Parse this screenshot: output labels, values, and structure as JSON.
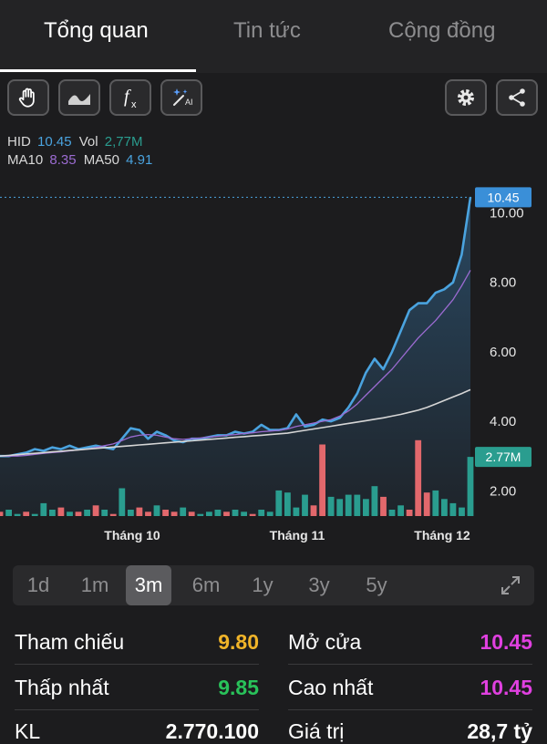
{
  "tabs": [
    {
      "label": "Tổng quan",
      "active": true
    },
    {
      "label": "Tin tức",
      "active": false
    },
    {
      "label": "Cộng đồng",
      "active": false
    }
  ],
  "toolbar": {
    "icons": [
      "hand-icon",
      "line-style-icon",
      "function-icon",
      "magic-wand-icon",
      "gear-icon",
      "share-icon"
    ]
  },
  "info": {
    "ticker": "HID",
    "price": "10.45",
    "vol_label": "Vol",
    "vol": "2,77M",
    "ma10_label": "MA10",
    "ma10": "8.35",
    "ma50_label": "MA50",
    "ma50": "4.91"
  },
  "colors": {
    "price_line": "#4aa3df",
    "ma10": "#9b6bd1",
    "ma50": "#d6d6d6",
    "vol_up": "#2a9d8f",
    "vol_down": "#e2686c",
    "orange": "#f0b429",
    "green": "#29c25a",
    "magenta": "#e040e0"
  },
  "chart_data": {
    "type": "line",
    "x_ticks": [
      "Tháng 10",
      "Tháng 11",
      "Tháng 12"
    ],
    "y_ticks": [
      "10.00",
      "8.00",
      "6.00",
      "4.00",
      "2.00"
    ],
    "price_badge": "10.45",
    "vol_badge": "2.77M",
    "ylim": [
      1.3,
      10.8
    ],
    "series": [
      {
        "name": "HID",
        "values": [
          3.0,
          3.0,
          3.05,
          3.1,
          3.2,
          3.15,
          3.25,
          3.2,
          3.3,
          3.2,
          3.25,
          3.3,
          3.25,
          3.2,
          3.5,
          3.8,
          3.75,
          3.5,
          3.7,
          3.6,
          3.45,
          3.4,
          3.5,
          3.5,
          3.55,
          3.6,
          3.6,
          3.7,
          3.65,
          3.7,
          3.9,
          3.75,
          3.75,
          3.8,
          4.2,
          3.85,
          3.9,
          4.05,
          4.0,
          4.1,
          4.4,
          4.8,
          5.4,
          5.8,
          5.5,
          6.0,
          6.6,
          7.2,
          7.4,
          7.4,
          7.7,
          7.8,
          8.0,
          8.8,
          10.45
        ]
      },
      {
        "name": "MA10",
        "values": [
          3.0,
          3.0,
          3.0,
          3.02,
          3.05,
          3.08,
          3.1,
          3.12,
          3.15,
          3.18,
          3.2,
          3.25,
          3.3,
          3.35,
          3.45,
          3.55,
          3.6,
          3.62,
          3.6,
          3.55,
          3.5,
          3.48,
          3.5,
          3.52,
          3.55,
          3.57,
          3.6,
          3.62,
          3.65,
          3.67,
          3.7,
          3.72,
          3.74,
          3.78,
          3.85,
          3.9,
          3.95,
          4.0,
          4.05,
          4.15,
          4.3,
          4.5,
          4.75,
          5.0,
          5.25,
          5.5,
          5.8,
          6.1,
          6.4,
          6.65,
          6.9,
          7.2,
          7.5,
          7.9,
          8.35
        ]
      },
      {
        "name": "MA50",
        "values": [
          3.0,
          3.02,
          3.04,
          3.06,
          3.08,
          3.1,
          3.12,
          3.14,
          3.16,
          3.18,
          3.2,
          3.22,
          3.24,
          3.26,
          3.28,
          3.3,
          3.32,
          3.34,
          3.36,
          3.38,
          3.4,
          3.42,
          3.44,
          3.46,
          3.48,
          3.5,
          3.52,
          3.54,
          3.56,
          3.58,
          3.6,
          3.62,
          3.64,
          3.66,
          3.7,
          3.74,
          3.78,
          3.82,
          3.86,
          3.9,
          3.94,
          3.98,
          4.02,
          4.06,
          4.1,
          4.15,
          4.2,
          4.26,
          4.32,
          4.4,
          4.5,
          4.6,
          4.7,
          4.8,
          4.91
        ]
      }
    ],
    "volume": {
      "ylim": [
        0,
        3.5
      ],
      "values": [
        0.2,
        0.3,
        0.1,
        0.2,
        0.1,
        0.6,
        0.3,
        0.4,
        0.2,
        0.2,
        0.3,
        0.5,
        0.3,
        0.1,
        1.3,
        0.3,
        0.4,
        0.2,
        0.5,
        0.3,
        0.2,
        0.4,
        0.2,
        0.1,
        0.2,
        0.3,
        0.2,
        0.3,
        0.2,
        0.1,
        0.3,
        0.2,
        1.2,
        1.1,
        0.4,
        1.0,
        0.5,
        3.35,
        0.9,
        0.8,
        1.0,
        1.0,
        0.8,
        1.4,
        0.9,
        0.3,
        0.5,
        0.3,
        3.55,
        1.1,
        1.2,
        0.8,
        0.6,
        0.4,
        2.77
      ],
      "up": [
        0,
        1,
        1,
        0,
        1,
        1,
        1,
        0,
        1,
        0,
        1,
        0,
        1,
        0,
        1,
        1,
        0,
        0,
        1,
        0,
        0,
        1,
        0,
        1,
        1,
        1,
        0,
        1,
        1,
        0,
        1,
        1,
        1,
        1,
        1,
        1,
        0,
        0,
        1,
        1,
        1,
        1,
        1,
        1,
        0,
        1,
        1,
        0,
        0,
        0,
        1,
        1,
        1,
        1,
        1
      ]
    }
  },
  "periods": [
    {
      "label": "1d",
      "active": false
    },
    {
      "label": "1m",
      "active": false
    },
    {
      "label": "3m",
      "active": true
    },
    {
      "label": "6m",
      "active": false
    },
    {
      "label": "1y",
      "active": false
    },
    {
      "label": "3y",
      "active": false
    },
    {
      "label": "5y",
      "active": false
    }
  ],
  "stats": [
    {
      "label": "Tham chiếu",
      "value": "9.80",
      "color": "#f0b429"
    },
    {
      "label": "Mở cửa",
      "value": "10.45",
      "color": "#e040e0"
    },
    {
      "label": "Thấp nhất",
      "value": "9.85",
      "color": "#29c25a"
    },
    {
      "label": "Cao nhất",
      "value": "10.45",
      "color": "#e040e0"
    },
    {
      "label": "KL",
      "value": "2.770.100",
      "color": "#ffffff"
    },
    {
      "label": "Giá trị",
      "value": "28,7 tỷ",
      "color": "#ffffff"
    }
  ]
}
